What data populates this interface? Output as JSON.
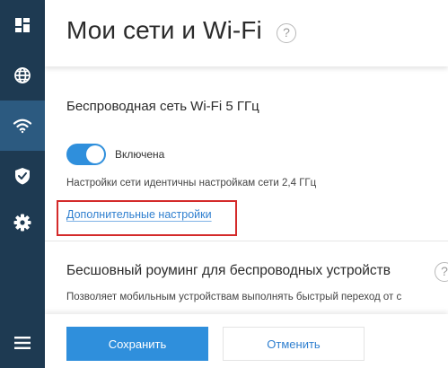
{
  "header": {
    "title": "Мои сети и Wi-Fi",
    "help_glyph": "?"
  },
  "sidebar": {
    "items": [
      {
        "icon": "dashboard-icon",
        "active": false
      },
      {
        "icon": "globe-icon",
        "active": false
      },
      {
        "icon": "wifi-icon",
        "active": true
      },
      {
        "icon": "shield-icon",
        "active": false
      },
      {
        "icon": "gear-icon",
        "active": false
      },
      {
        "icon": "menu-icon",
        "active": false
      }
    ]
  },
  "wifi5": {
    "title": "Беспроводная сеть Wi-Fi 5 ГГц",
    "toggle_on": true,
    "toggle_label": "Включена",
    "note": "Настройки сети идентичны настройкам сети 2,4 ГГц",
    "advanced_link": "Дополнительные настройки"
  },
  "roaming": {
    "title": "Бесшовный роуминг для беспроводных устройств",
    "help_glyph": "?",
    "description": "Позволяет мобильным устройствам выполнять быстрый переход от с"
  },
  "footer": {
    "save_label": "Сохранить",
    "cancel_label": "Отменить"
  },
  "colors": {
    "sidebar_bg": "#1e3a52",
    "sidebar_active": "#2c5a80",
    "accent": "#2f8fdc",
    "highlight_border": "#d42a2a"
  }
}
